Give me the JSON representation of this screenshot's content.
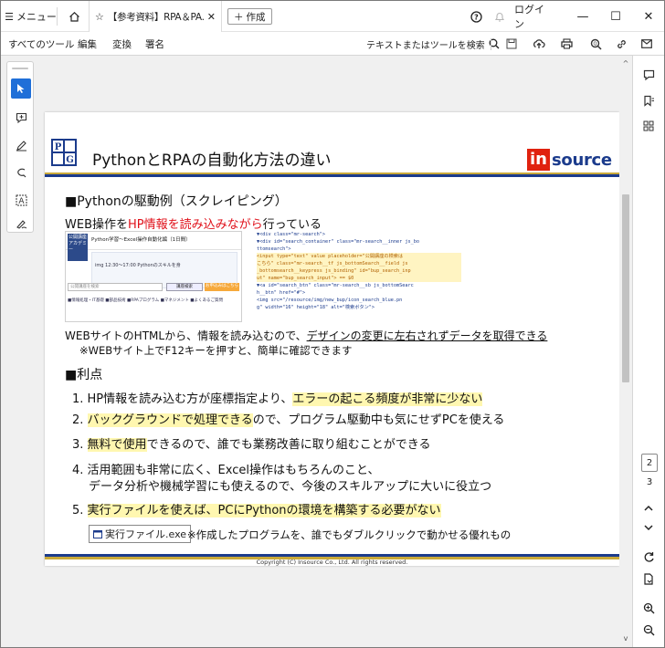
{
  "titlebar": {
    "menu_label": "メニュー",
    "tab_title": "【参考資料】RPA＆PA...",
    "create_label": "作成",
    "login_label": "ログイン"
  },
  "menubar": {
    "all_tools": "すべてのツール",
    "edit": "編集",
    "convert": "変換",
    "sign": "署名",
    "search_label": "テキストまたはツールを検索"
  },
  "slide": {
    "title": "PythonとRPAの自動化方法の違い",
    "brand_in": "in",
    "brand_source": "source",
    "section_example": "■Pythonの駆動例（スクレイピング）",
    "web_pre": "WEB操作を",
    "web_red": "HP情報を読み込みながら",
    "web_post": "行っている",
    "thumb_left": {
      "logo": "公開講座アカデミー",
      "title": "Python学習〜Excel操作自動化編（1日間）",
      "body": "img   12:30〜17:00   Pythonのスキルを身",
      "search": "公開講座を検索",
      "btn1": "講座検索",
      "btn2": "お申込みはこちら",
      "links": "■情報処理・IT基礎   ■部品技術   ■RPAプログラム   ■マネジメント   ■よくあるご質問"
    },
    "code_lines": [
      "▼<div class=\"mr-search\">",
      "  ▼<div id=\"search_container\" class=\"mr-search__inner js_bo",
      "     ttomsearch\">",
      "     <input type=\"text\" value placeholder=\"公開講座の検索は",
      "     こちら\" class=\"mr-search__tf js_bottomSearch__field js",
      "     _bottomsearch__keypress js_binding\" id=\"bup_search_inp",
      "     ut\" name=\"bup_search_input\"> == $0",
      "   ▼<a id=\"search_btn\" class=\"mr-search__sb js_bottomSearc",
      "     h__btn\" href=\"#\">",
      "       <img src=\"/resource/img/new_bup/icon_search_blue.pn",
      "       g\" width=\"16\" height=\"18\" alt=\"検索ボタン\">"
    ],
    "html_pre": "WEBサイトのHTMLから、情報を読み込むので、",
    "html_underline": "デザインの変更に左右されずデータを取得できる",
    "f12_note": "※WEBサイト上でF12キーを押すと、簡単に確認できます",
    "section_adv": "■利点",
    "adv1_pre": "1. HP情報を読み込む方が座標指定より、",
    "adv1_hl": "エラーの起こる頻度が非常に少ない",
    "adv2_num": "2. ",
    "adv2_hl": "バックグラウンドで処理できる",
    "adv2_post": "ので、プログラム駆動中も気にせずPCを使える",
    "adv3_num": "3. ",
    "adv3_hl": "無料で使用",
    "adv3_post": "できるので、誰でも業務改善に取り組むことができる",
    "adv4_line1": "4. 活用範囲も非常に広く、Excel操作はもちろんのこと、",
    "adv4_line2": "データ分析や機械学習にも使えるので、今後のスキルアップに大いに役立つ",
    "adv5_num": "5. ",
    "adv5_hl": "実行ファイルを使えば、PCにPythonの環境を構築する必要がない",
    "exe_label": "実行ファイル.exe",
    "exe_note": "※作成したプログラムを、誰でもダブルクリックで動かせる優れもの",
    "copyright": "Copyright (C) Insource Co., Ltd. All rights reserved."
  },
  "pager": {
    "current": "2",
    "total": "3"
  },
  "colors": {
    "accent_blue": "#1f6fd8",
    "brand_red": "#e0220f",
    "brand_navy": "#1b3b8c",
    "gold": "#c9a93a",
    "highlight": "#fff7b0"
  }
}
